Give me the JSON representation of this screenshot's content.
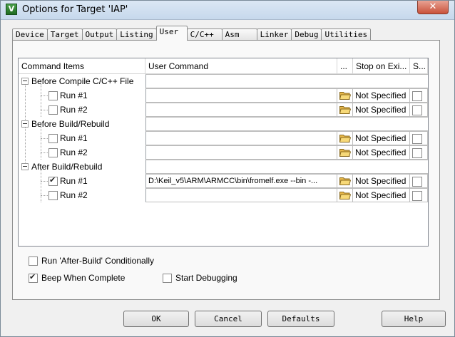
{
  "window": {
    "title": "Options for Target 'IAP'",
    "app_icon_glyph": "V",
    "close_glyph": "✕"
  },
  "tabs": [
    {
      "label": "Device",
      "active": false
    },
    {
      "label": "Target",
      "active": false
    },
    {
      "label": "Output",
      "active": false
    },
    {
      "label": "Listing",
      "active": false
    },
    {
      "label": "User",
      "active": true
    },
    {
      "label": "C/C++",
      "active": false
    },
    {
      "label": "Asm",
      "active": false
    },
    {
      "label": "Linker",
      "active": false
    },
    {
      "label": "Debug",
      "active": false
    },
    {
      "label": "Utilities",
      "active": false
    }
  ],
  "grid": {
    "headers": {
      "command_items": "Command Items",
      "user_command": "User Command",
      "browse": "...",
      "stop_on_exit": "Stop on Exi...",
      "s": "S..."
    },
    "groups": [
      {
        "label": "Before Compile C/C++ File",
        "runs": [
          {
            "label": "Run #1",
            "checked": false,
            "command": "",
            "stop": "Not Specified"
          },
          {
            "label": "Run #2",
            "checked": false,
            "command": "",
            "stop": "Not Specified"
          }
        ]
      },
      {
        "label": "Before Build/Rebuild",
        "runs": [
          {
            "label": "Run #1",
            "checked": false,
            "command": "",
            "stop": "Not Specified"
          },
          {
            "label": "Run #2",
            "checked": false,
            "command": "",
            "stop": "Not Specified"
          }
        ]
      },
      {
        "label": "After Build/Rebuild",
        "runs": [
          {
            "label": "Run #1",
            "checked": true,
            "command": "D:\\Keil_v5\\ARM\\ARMCC\\bin\\fromelf.exe --bin -...",
            "stop": "Not Specified"
          },
          {
            "label": "Run #2",
            "checked": false,
            "command": "",
            "stop": "Not Specified"
          }
        ]
      }
    ]
  },
  "options": {
    "run_after_build": {
      "label": "Run 'After-Build' Conditionally",
      "checked": false
    },
    "beep_when_complete": {
      "label": "Beep When Complete",
      "checked": true
    },
    "start_debugging": {
      "label": "Start Debugging",
      "checked": false
    }
  },
  "buttons": {
    "ok": "OK",
    "cancel": "Cancel",
    "defaults": "Defaults",
    "help": "Help"
  },
  "colors": {
    "folder": "#e8b84a"
  }
}
